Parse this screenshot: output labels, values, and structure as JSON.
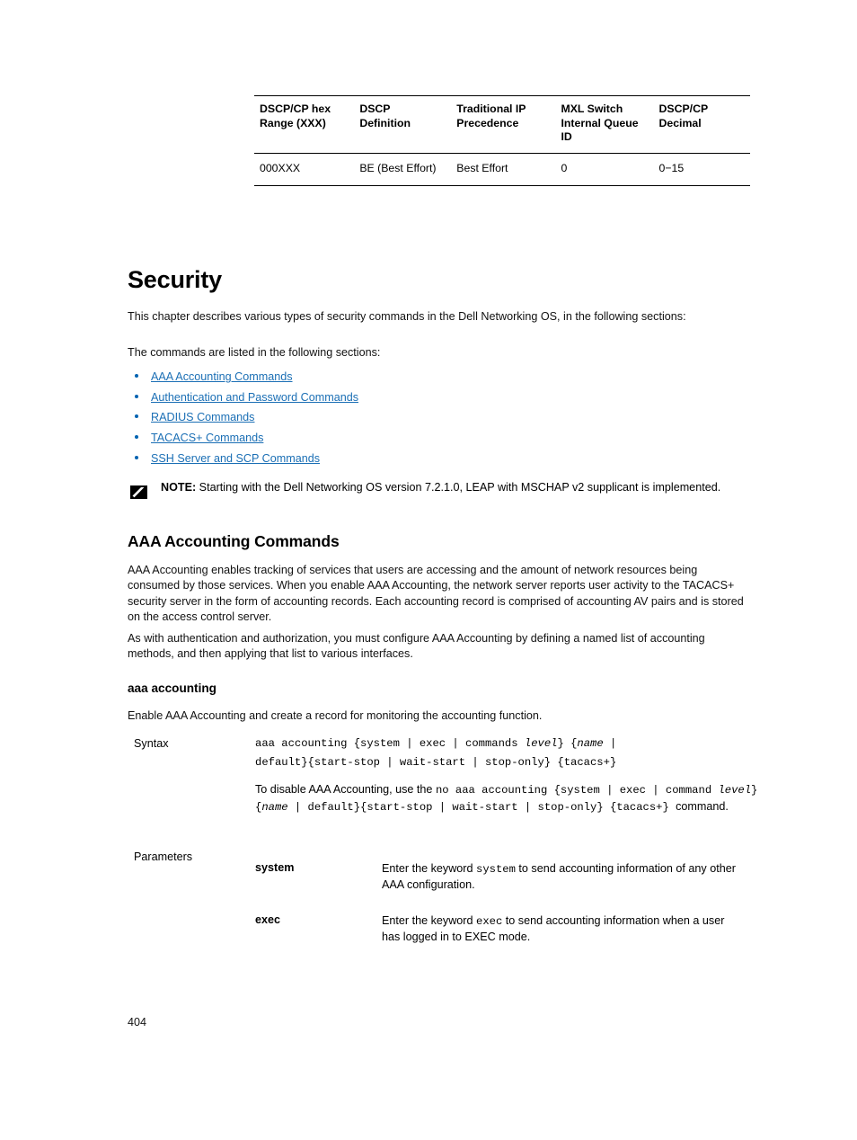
{
  "table": {
    "headers": [
      "DSCP/CP hex Range (XXX)",
      "DSCP Definition",
      "Traditional IP Precedence",
      "MXL Switch Internal Queue ID",
      "DSCP/CP Decimal"
    ],
    "rows": [
      [
        "000XXX",
        "BE (Best Effort)",
        "Best Effort",
        "0",
        "0−15"
      ]
    ]
  },
  "chapter": {
    "title": "Security",
    "intro": "This chapter describes various types of security commands in the Dell Networking OS, in the following sections:",
    "listing_intro": "The commands are listed in the following sections:",
    "links": [
      "AAA Accounting Commands",
      "Authentication and Password Commands",
      "RADIUS Commands",
      "TACACS+ Commands",
      "SSH Server and SCP Commands"
    ]
  },
  "note": {
    "label": "NOTE:",
    "text": " Starting with the Dell Networking OS version 7.2.1.0, LEAP with MSCHAP v2 supplicant is implemented."
  },
  "section": {
    "title": "AAA Accounting Commands",
    "para1": "AAA Accounting enables tracking of services that users are accessing and the amount of network resources being consumed by those services. When you enable AAA Accounting, the network server reports user activity to the TACACS+ security server in the form of accounting records. Each accounting record is comprised of accounting AV pairs and is stored on the access control server.",
    "para2": "As with authentication and authorization, you must configure AAA Accounting by defining a named list of accounting methods, and then applying that list to various interfaces."
  },
  "command": {
    "name": "aaa accounting",
    "description": "Enable AAA Accounting and create a record for monitoring the accounting function.",
    "syntax_label": "Syntax",
    "syntax_line1_a": "aaa accounting {system | exec | commands ",
    "syntax_line1_b": "level",
    "syntax_line1_c": "} {",
    "syntax_line1_d": "name",
    "syntax_line1_e": " |",
    "syntax_line2": "default}{start-stop | wait-start | stop-only} {tacacs+}",
    "disable_pre": "To disable AAA Accounting, use the ",
    "disable_code1": "no aaa accounting {system | exec | command ",
    "disable_italic1": "level",
    "disable_code2": "} {",
    "disable_italic2": "name",
    "disable_code3": " | default}{start-stop | wait-start | stop-only} {tacacs+} ",
    "disable_post": "command.",
    "parameters_label": "Parameters",
    "parameters": [
      {
        "name": "system",
        "desc_pre": "Enter the keyword ",
        "desc_code": "system",
        "desc_post": " to send accounting information of any other AAA configuration."
      },
      {
        "name": "exec",
        "desc_pre": "Enter the keyword ",
        "desc_code": "exec",
        "desc_post": " to send accounting information when a user has logged in to EXEC mode."
      }
    ]
  },
  "footer": {
    "page_number": "404"
  },
  "colors": {
    "link": "#1b6fb5",
    "text": "#111111"
  }
}
